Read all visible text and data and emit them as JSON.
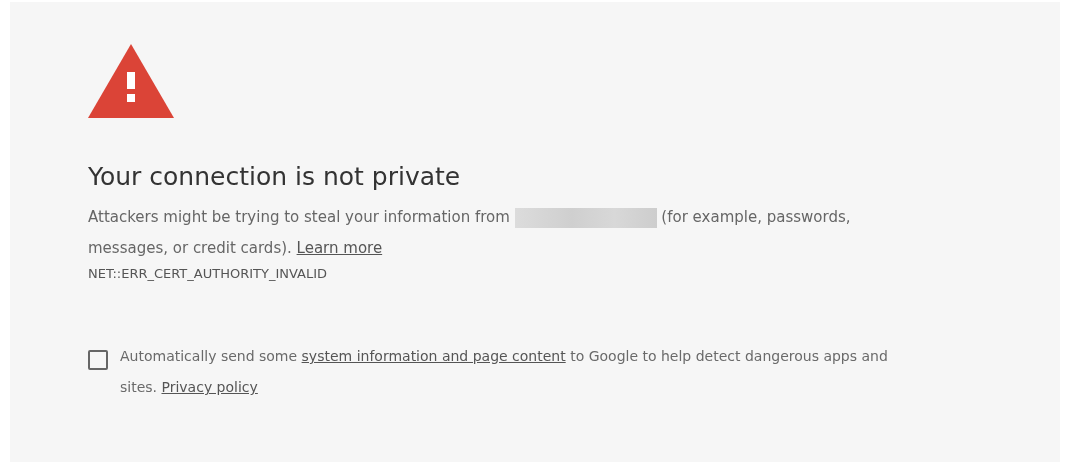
{
  "heading": "Your connection is not private",
  "message": {
    "before": "Attackers might be trying to steal your information from",
    "domain_redacted": true,
    "after": "(for example, passwords, messages, or credit cards).",
    "link": "Learn more"
  },
  "error_code": "NET::ERR_CERT_AUTHORITY_INVALID",
  "report": {
    "checked": false,
    "before": "Automatically send some",
    "link": "system information and page content",
    "after": "to Google to help detect dangerous apps and sites.",
    "policy_link": "Privacy policy"
  }
}
